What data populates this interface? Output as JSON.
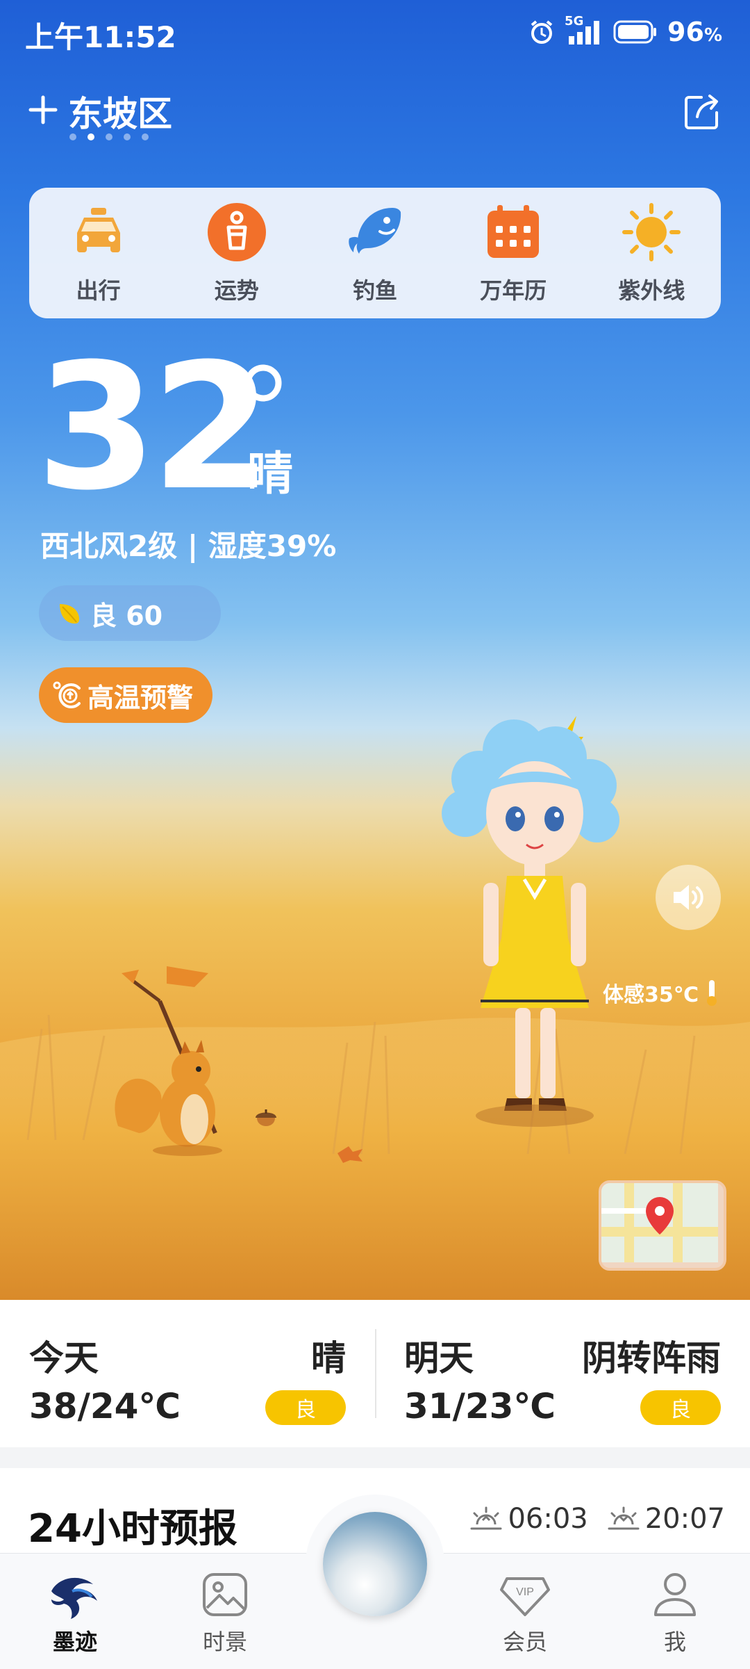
{
  "status": {
    "time": "上午11:52",
    "network": "5G",
    "battery": "96",
    "battery_unit": "%"
  },
  "header": {
    "city": "东坡区",
    "page_count": 5,
    "active_page": 2
  },
  "quick_actions": [
    {
      "label": "出行",
      "icon": "taxi-icon",
      "color": "#f2a63a"
    },
    {
      "label": "运势",
      "icon": "fortune-icon",
      "color": "#f2702a"
    },
    {
      "label": "钓鱼",
      "icon": "fish-icon",
      "color": "#3a86e0"
    },
    {
      "label": "万年历",
      "icon": "calendar-icon",
      "color": "#f2702a"
    },
    {
      "label": "紫外线",
      "icon": "sun-icon",
      "color": "#f5b026"
    }
  ],
  "current": {
    "temperature": "32",
    "condition": "晴",
    "wind_humidity": "西北风2级 | 湿度39%",
    "aqi": "良 60",
    "warning": "高温预警",
    "feels_like": "体感35℃"
  },
  "daily": [
    {
      "day": "今天",
      "condition": "晴",
      "temp": "38/24℃",
      "aqi": "良"
    },
    {
      "day": "明天",
      "condition": "阴转阵雨",
      "temp": "31/23℃",
      "aqi": "良"
    }
  ],
  "forecast": {
    "title": "24小时预报",
    "sunrise": "06:03",
    "sunset": "20:07"
  },
  "nav": [
    {
      "label": "墨迹",
      "icon": "moji-logo-icon",
      "active": true
    },
    {
      "label": "时景",
      "icon": "photo-icon",
      "active": false
    },
    {
      "label": "会员",
      "icon": "vip-icon",
      "active": false
    },
    {
      "label": "我",
      "icon": "profile-icon",
      "active": false
    }
  ],
  "colors": {
    "accent_orange": "#f0902c",
    "badge_yellow": "#f7c400",
    "sky_blue": "#2d78e2"
  }
}
